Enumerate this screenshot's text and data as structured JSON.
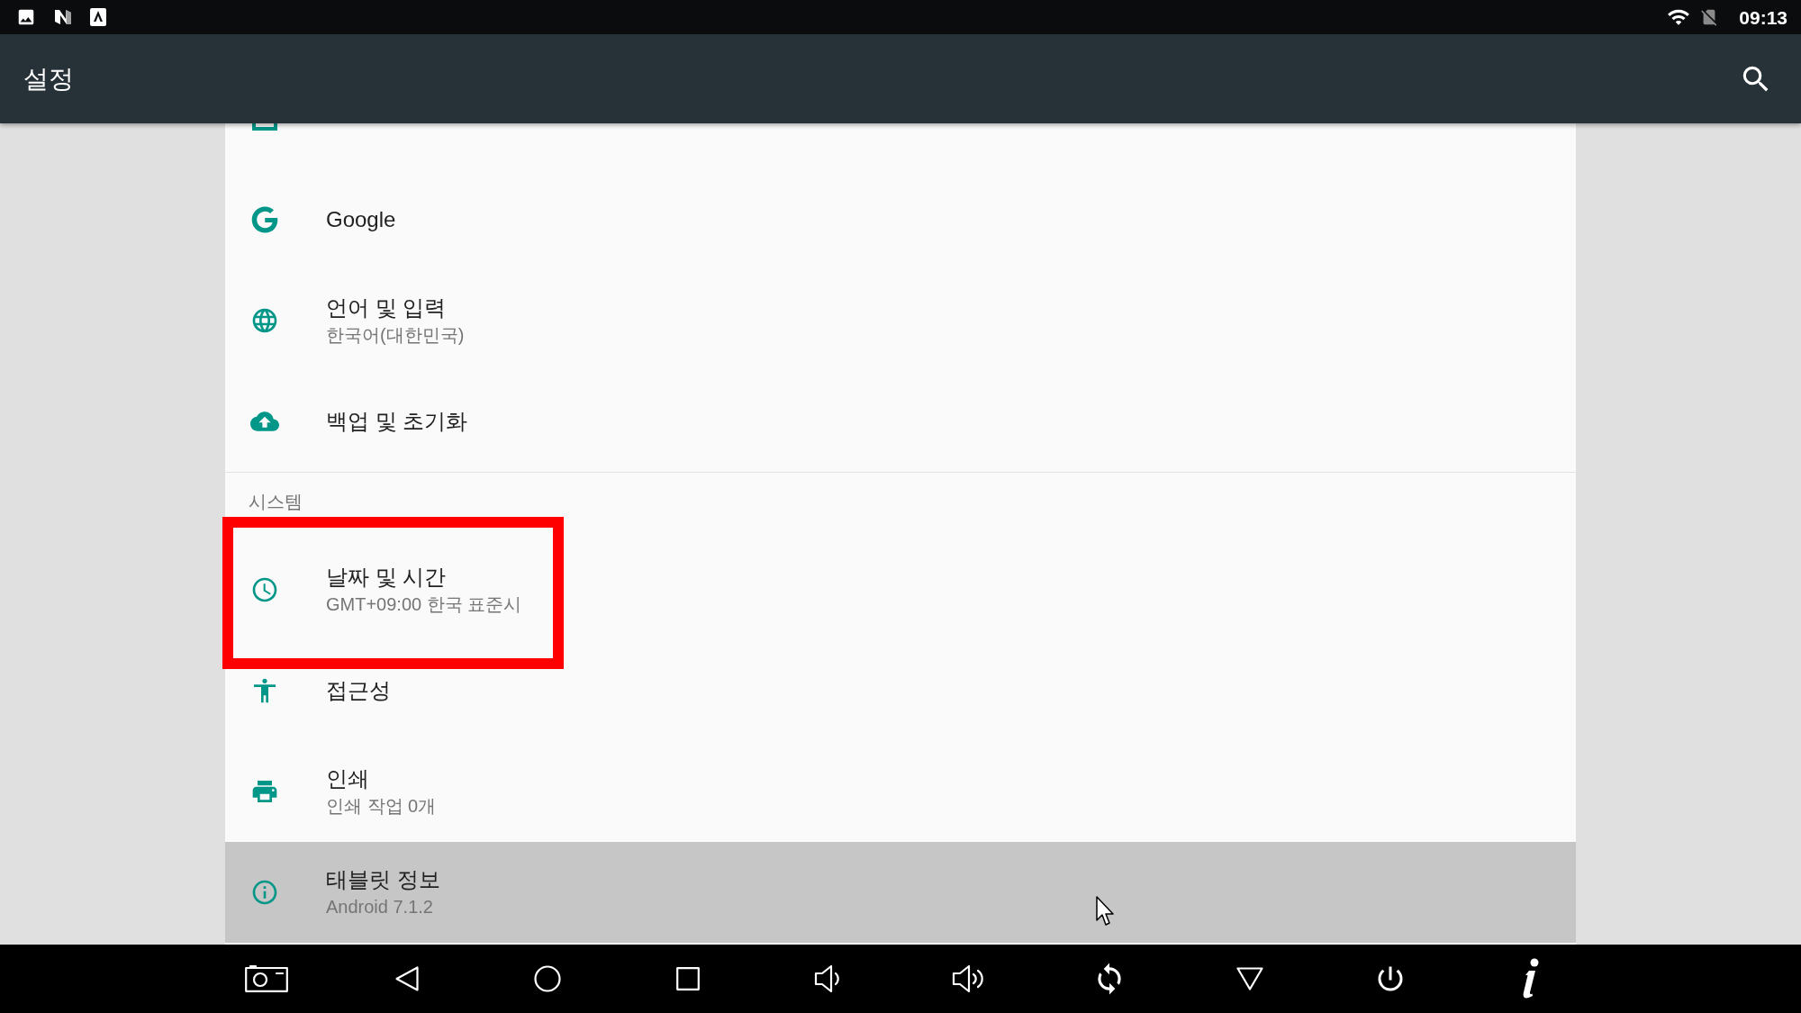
{
  "status_bar": {
    "time": "09:13"
  },
  "app_bar": {
    "title": "설정"
  },
  "sections": [
    {
      "items": [
        {
          "title": "Google",
          "pressed": false,
          "framed": false
        },
        {
          "title": "언어 및 입력",
          "subtitle": "한국어(대한민국)",
          "pressed": false,
          "framed": false
        },
        {
          "title": "백업 및 초기화",
          "pressed": false,
          "framed": false
        }
      ]
    },
    {
      "header": "시스템",
      "items": [
        {
          "title": "날짜 및 시간",
          "subtitle": "GMT+09:00 한국 표준시",
          "pressed": false,
          "framed": true
        },
        {
          "title": "접근성",
          "pressed": false,
          "framed": false
        },
        {
          "title": "인쇄",
          "subtitle": "인쇄 작업 0개",
          "pressed": false,
          "framed": false
        },
        {
          "title": "태블릿 정보",
          "subtitle": "Android 7.1.2",
          "pressed": true,
          "framed": false
        }
      ]
    }
  ]
}
